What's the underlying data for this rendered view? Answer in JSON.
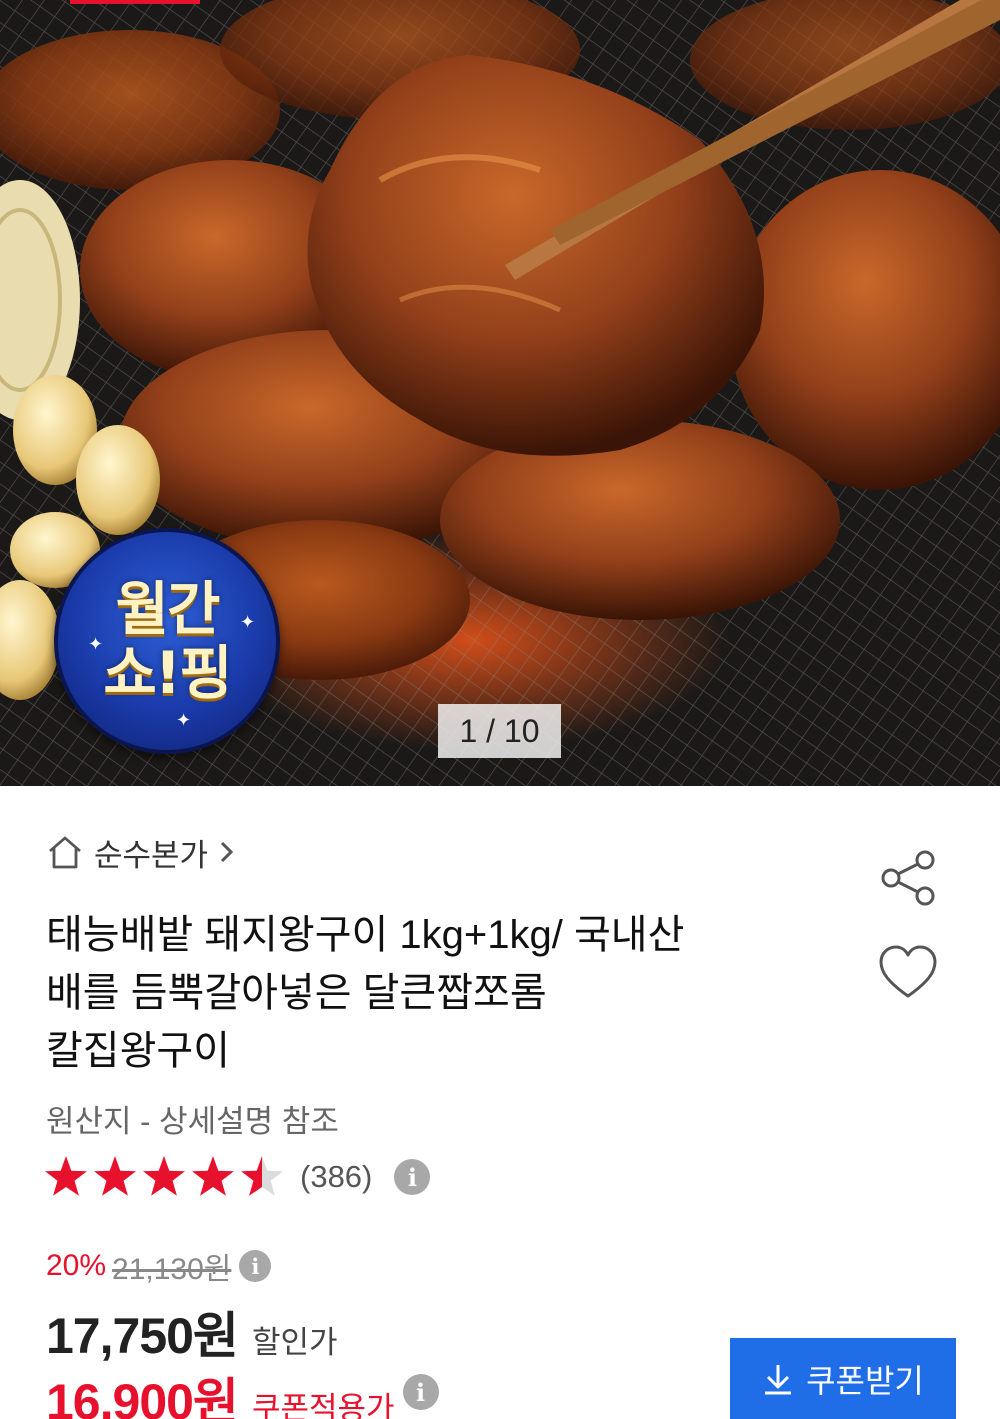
{
  "gallery": {
    "counter": "1 / 10",
    "badge_line1": "월간",
    "badge_line2": "쇼!핑"
  },
  "store": {
    "icon": "home-icon",
    "name": "순수본가"
  },
  "product": {
    "title_lines": [
      "태능배밭 돼지왕구이 1kg+1kg/ 국내산",
      "배를 듬뿍갈아넣은 달큰짭쪼롬",
      "칼집왕구이"
    ],
    "origin": "원산지 - 상세설명 참조"
  },
  "rating": {
    "stars": 4.5,
    "max": 5,
    "count": "(386)"
  },
  "price": {
    "discount_rate": "20%",
    "original": "21,130원",
    "sale": "17,750원",
    "sale_label": "할인가",
    "coupon": "16,900원",
    "coupon_label": "쿠폰적용가"
  },
  "actions": {
    "coupon_button": "쿠폰받기"
  },
  "colors": {
    "accent_red": "#e8112d",
    "button_blue": "#1f6ee8"
  }
}
